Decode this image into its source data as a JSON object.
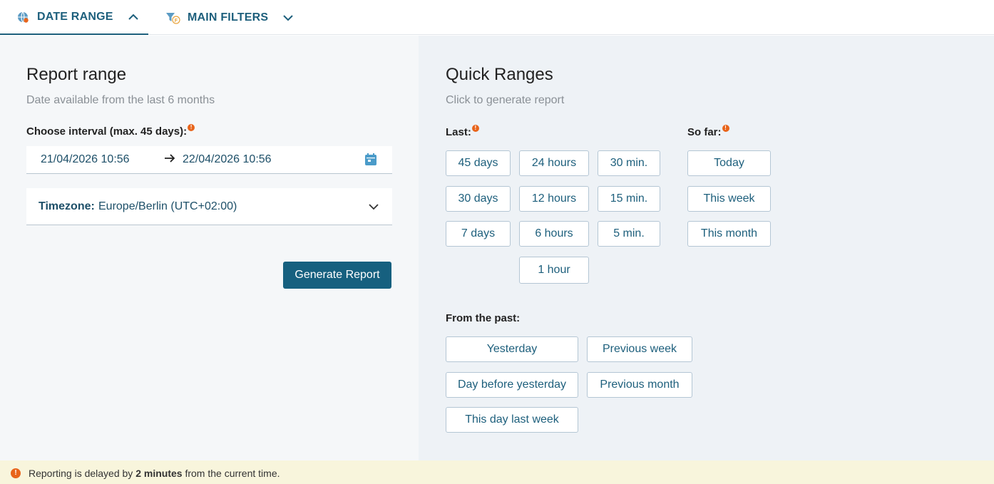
{
  "tabs": {
    "date_range": "DATE RANGE",
    "main_filters": "MAIN FILTERS"
  },
  "report_range": {
    "title": "Report range",
    "subtitle": "Date available from the last 6 months",
    "interval_label": "Choose interval (max. 45 days):",
    "from_value": "21/04/2026 10:56",
    "to_value": "22/04/2026 10:56",
    "timezone_label": "Timezone:",
    "timezone_value": "Europe/Berlin (UTC+02:00)",
    "generate_label": "Generate Report"
  },
  "quick_ranges": {
    "title": "Quick Ranges",
    "subtitle": "Click to generate report",
    "last_label": "Last:",
    "so_far_label": "So far:",
    "past_label": "From the past:",
    "last": [
      "45 days",
      "24 hours",
      "30 min.",
      "30 days",
      "12 hours",
      "15 min.",
      "7 days",
      "6 hours",
      "5 min.",
      "1 hour"
    ],
    "so_far": [
      "Today",
      "This week",
      "This month"
    ],
    "past": [
      "Yesterday",
      "Previous week",
      "Day before yesterday",
      "Previous month",
      "This day last week"
    ]
  },
  "notice": {
    "prefix": "Reporting is delayed by ",
    "bold": "2 minutes",
    "suffix": " from the current time."
  },
  "colors": {
    "accent": "#16607f",
    "warning": "#e8641b",
    "notice_bg": "#f8f5dc"
  }
}
